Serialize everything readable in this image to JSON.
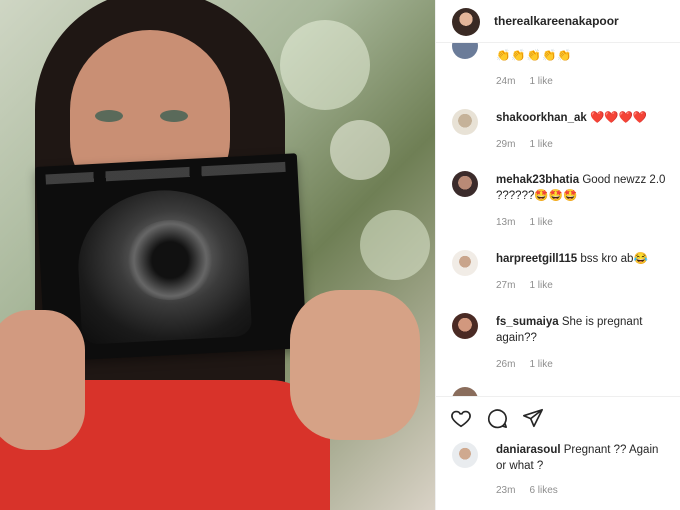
{
  "header": {
    "username": "therealkareenakapoor"
  },
  "comments": [
    {
      "username": "",
      "text": "",
      "emoji": "👏👏👏👏👏",
      "time": "24m",
      "likes": "1 like"
    },
    {
      "username": "shakoorkhan_ak",
      "text": "",
      "emoji": "❤️❤️❤️❤️",
      "time": "29m",
      "likes": "1 like"
    },
    {
      "username": "mehak23bhatia",
      "text": "Good newzz 2.0 ??????",
      "emoji": "🤩🤩🤩",
      "time": "13m",
      "likes": "1 like"
    },
    {
      "username": "harpreetgill115",
      "text": "bss kro ab",
      "emoji": "😂",
      "time": "27m",
      "likes": "1 like"
    },
    {
      "username": "fs_sumaiya",
      "text": "She is pregnant again??",
      "emoji": "",
      "time": "26m",
      "likes": "1 like"
    }
  ],
  "pinned_comment": {
    "username": "daniarasoul",
    "text": "Pregnant ?? Again or what ?",
    "time": "23m",
    "likes": "6 likes"
  },
  "icons": {
    "like": "heart-outline-icon",
    "comment": "comment-bubble-icon",
    "share": "paper-plane-icon"
  },
  "colors": {
    "heart_red": "#ed1c24",
    "meta_gray": "#8e8e8e"
  }
}
